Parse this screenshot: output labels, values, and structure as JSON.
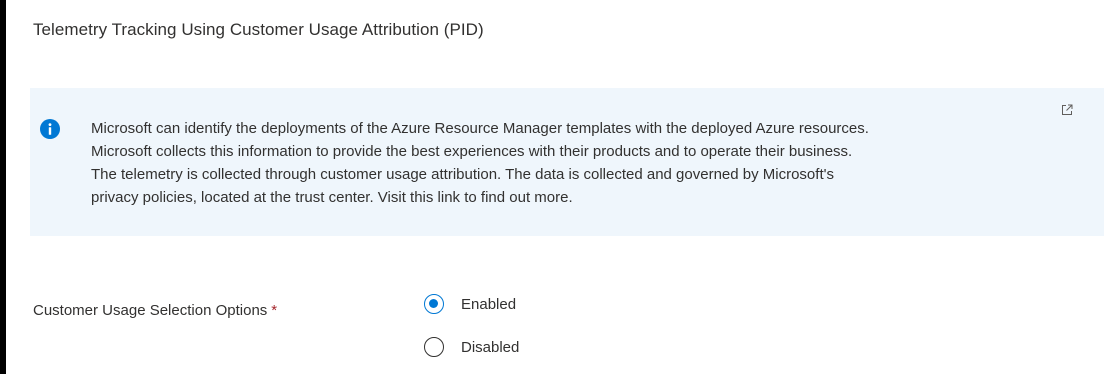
{
  "section": {
    "title": "Telemetry Tracking Using Customer Usage Attribution (PID)"
  },
  "info": {
    "icon": "info-icon",
    "link_icon": "external-link-icon",
    "lines": [
      "Microsoft can identify the deployments of the Azure Resource Manager templates with the deployed Azure resources.",
      "Microsoft collects this information to provide the best experiences with their products and to operate their business.",
      "The telemetry is collected through customer usage attribution. The data is collected and governed by Microsoft's",
      "privacy policies, located at the trust center. Visit this link to find out more."
    ]
  },
  "field": {
    "label": "Customer Usage Selection Options",
    "required_marker": "*",
    "selected": "Enabled",
    "options": [
      {
        "label": "Enabled",
        "checked": true
      },
      {
        "label": "Disabled",
        "checked": false
      }
    ]
  },
  "colors": {
    "accent": "#0078d4",
    "info_background": "#eff6fc",
    "text": "#323130",
    "required": "#a4262c"
  }
}
